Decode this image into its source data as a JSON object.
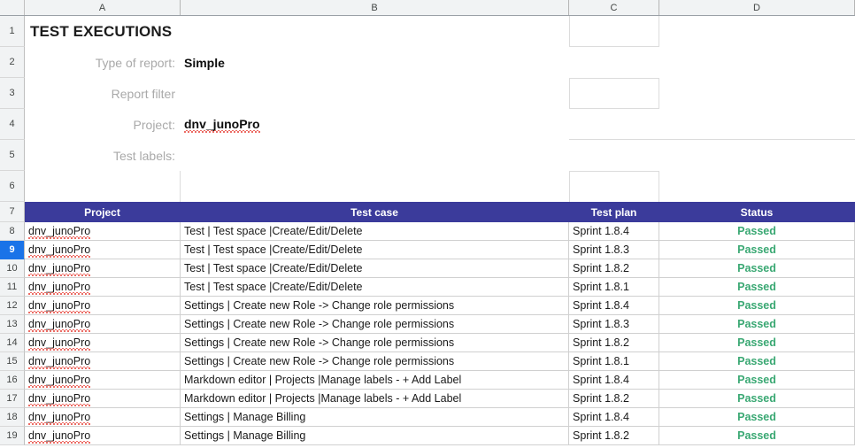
{
  "columns": [
    {
      "id": "A",
      "label": "A"
    },
    {
      "id": "B",
      "label": "B"
    },
    {
      "id": "C",
      "label": "C"
    },
    {
      "id": "D",
      "label": "D"
    }
  ],
  "row_numbers": [
    "1",
    "2",
    "3",
    "4",
    "5",
    "6",
    "7",
    "8",
    "9",
    "10",
    "11",
    "12",
    "13",
    "14",
    "15",
    "16",
    "17",
    "18",
    "19"
  ],
  "selection": {
    "selected_row": "9"
  },
  "colors": {
    "table_header_bg": "#3b3b9b",
    "table_header_text": "#ffffff",
    "status_passed": "#3aa873",
    "row_selected": "#1a73e8",
    "label_gray": "#a9a9a9",
    "grid_line": "#d0d0d0"
  },
  "report": {
    "title": "TEST EXECUTIONS",
    "fields": [
      {
        "row": "2",
        "label": "Type of report:",
        "value": "Simple",
        "spellcheck": false
      },
      {
        "row": "3",
        "label": "Report filter",
        "value": "",
        "spellcheck": false
      },
      {
        "row": "4",
        "label": "Project:",
        "value": "dnv_junoPro",
        "spellcheck": true
      },
      {
        "row": "5",
        "label": "Test labels:",
        "value": "",
        "spellcheck": false
      }
    ]
  },
  "table": {
    "header_row_number": "7",
    "headers": [
      "Project",
      "Test case",
      "Test plan",
      "Status"
    ],
    "rows": [
      {
        "n": "8",
        "project": "dnv_junoPro",
        "test_case": "Test | Test space |Create/Edit/Delete",
        "test_plan": "Sprint 1.8.4",
        "status": "Passed"
      },
      {
        "n": "9",
        "project": "dnv_junoPro",
        "test_case": "Test | Test space |Create/Edit/Delete",
        "test_plan": "Sprint 1.8.3",
        "status": "Passed"
      },
      {
        "n": "10",
        "project": "dnv_junoPro",
        "test_case": "Test | Test space |Create/Edit/Delete",
        "test_plan": "Sprint 1.8.2",
        "status": "Passed"
      },
      {
        "n": "11",
        "project": "dnv_junoPro",
        "test_case": "Test | Test space |Create/Edit/Delete",
        "test_plan": "Sprint 1.8.1",
        "status": "Passed"
      },
      {
        "n": "12",
        "project": "dnv_junoPro",
        "test_case": "Settings | Create new Role -> Change role permissions",
        "test_plan": "Sprint 1.8.4",
        "status": "Passed"
      },
      {
        "n": "13",
        "project": "dnv_junoPro",
        "test_case": "Settings | Create new Role -> Change role permissions",
        "test_plan": "Sprint 1.8.3",
        "status": "Passed"
      },
      {
        "n": "14",
        "project": "dnv_junoPro",
        "test_case": "Settings | Create new Role -> Change role permissions",
        "test_plan": "Sprint 1.8.2",
        "status": "Passed"
      },
      {
        "n": "15",
        "project": "dnv_junoPro",
        "test_case": "Settings | Create new Role -> Change role permissions",
        "test_plan": "Sprint 1.8.1",
        "status": "Passed"
      },
      {
        "n": "16",
        "project": "dnv_junoPro",
        "test_case": "Markdown editor | Projects |Manage labels - + Add Label",
        "test_plan": "Sprint 1.8.4",
        "status": "Passed"
      },
      {
        "n": "17",
        "project": "dnv_junoPro",
        "test_case": "Markdown editor | Projects |Manage labels - + Add Label",
        "test_plan": "Sprint 1.8.2",
        "status": "Passed"
      },
      {
        "n": "18",
        "project": "dnv_junoPro",
        "test_case": "Settings | Manage Billing",
        "test_plan": "Sprint 1.8.4",
        "status": "Passed"
      },
      {
        "n": "19",
        "project": "dnv_junoPro",
        "test_case": "Settings | Manage Billing",
        "test_plan": "Sprint 1.8.2",
        "status": "Passed"
      }
    ]
  }
}
